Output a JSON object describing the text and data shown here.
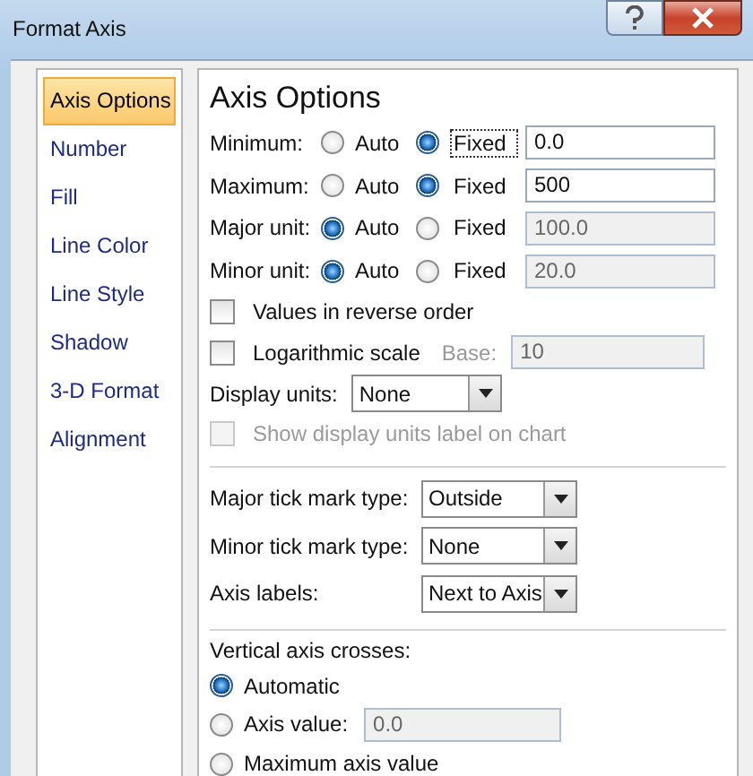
{
  "window": {
    "title": "Format Axis"
  },
  "sidebar": {
    "items": [
      {
        "label": "Axis Options",
        "selected": true
      },
      {
        "label": "Number",
        "selected": false
      },
      {
        "label": "Fill",
        "selected": false
      },
      {
        "label": "Line Color",
        "selected": false
      },
      {
        "label": "Line Style",
        "selected": false
      },
      {
        "label": "Shadow",
        "selected": false
      },
      {
        "label": "3-D Format",
        "selected": false
      },
      {
        "label": "Alignment",
        "selected": false
      }
    ]
  },
  "panel": {
    "heading": "Axis Options",
    "scale_rows": [
      {
        "label": "Minimum:",
        "auto_label": "Auto",
        "fixed_label": "Fixed",
        "auto_selected": false,
        "value": "0.0",
        "disabled": false,
        "focused": true
      },
      {
        "label": "Maximum:",
        "auto_label": "Auto",
        "fixed_label": "Fixed",
        "auto_selected": false,
        "value": "500",
        "disabled": false,
        "focused": false
      },
      {
        "label": "Major unit:",
        "auto_label": "Auto",
        "fixed_label": "Fixed",
        "auto_selected": true,
        "value": "100.0",
        "disabled": true,
        "focused": false
      },
      {
        "label": "Minor unit:",
        "auto_label": "Auto",
        "fixed_label": "Fixed",
        "auto_selected": true,
        "value": "20.0",
        "disabled": true,
        "focused": false
      }
    ],
    "reverse_order": {
      "label": "Values in reverse order",
      "checked": false
    },
    "log_scale": {
      "label": "Logarithmic scale",
      "checked": false,
      "base_label": "Base:",
      "base_value": "10"
    },
    "display_units": {
      "label": "Display units:",
      "value": "None"
    },
    "show_units_label": {
      "label": "Show display units label on chart",
      "checked": false,
      "disabled": true
    },
    "tick_settings": [
      {
        "label": "Major tick mark type:",
        "value": "Outside"
      },
      {
        "label": "Minor tick mark type:",
        "value": "None"
      },
      {
        "label": "Axis labels:",
        "value": "Next to Axis"
      }
    ],
    "crosses": {
      "label": "Vertical axis crosses:",
      "options": [
        {
          "label": "Automatic",
          "selected": true
        },
        {
          "label": "Axis value:",
          "selected": false,
          "value": "0.0"
        },
        {
          "label": "Maximum axis value",
          "selected": false
        }
      ]
    }
  }
}
